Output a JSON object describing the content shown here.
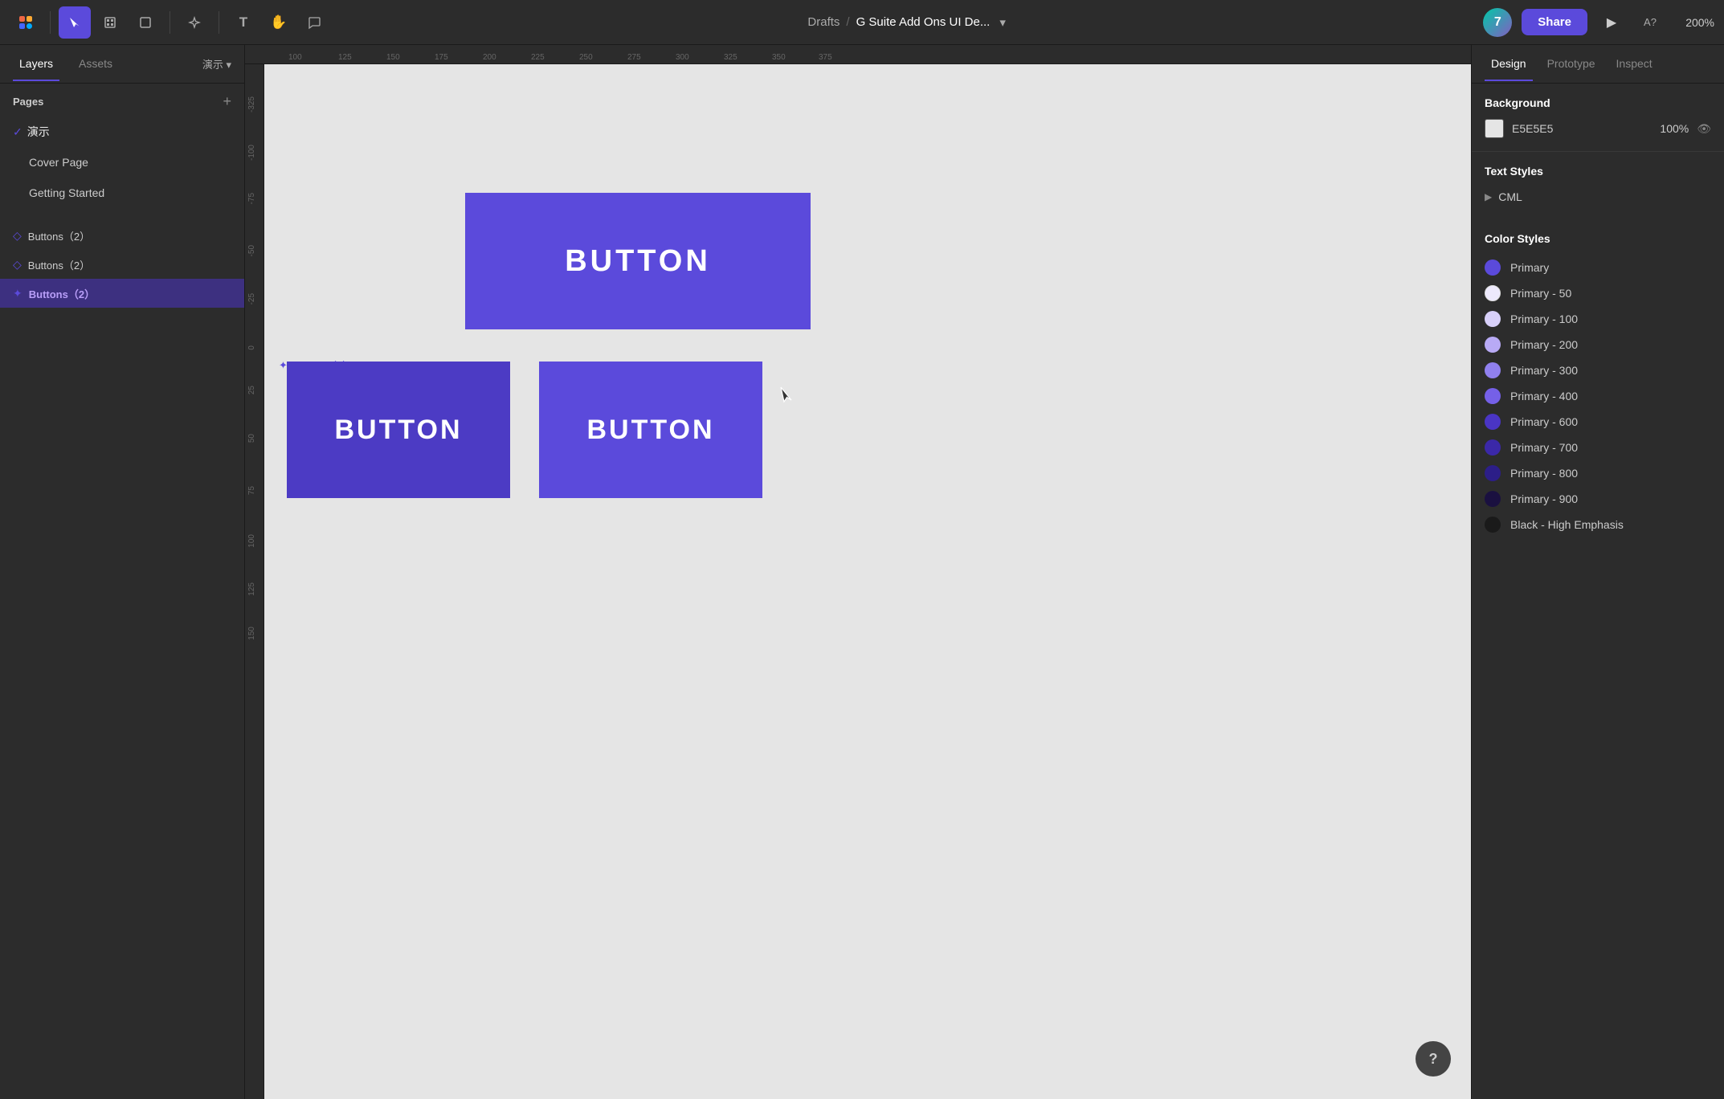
{
  "toolbar": {
    "breadcrumb_drafts": "Drafts",
    "breadcrumb_sep": "/",
    "page_title": "G Suite Add Ons UI De...",
    "share_label": "Share",
    "zoom_level": "200%",
    "avatar_initials": "7"
  },
  "left_panel": {
    "tabs": [
      {
        "id": "layers",
        "label": "Layers"
      },
      {
        "id": "assets",
        "label": "Assets"
      }
    ],
    "pages_section_title": "Pages",
    "pages": [
      {
        "id": "yanshi",
        "label": "演示",
        "active": true
      },
      {
        "id": "cover",
        "label": "Cover Page"
      },
      {
        "id": "getting-started",
        "label": "Getting Started"
      }
    ],
    "layers": [
      {
        "id": "buttons-1",
        "label": "Buttons（2）",
        "icon": "diamond",
        "active": false
      },
      {
        "id": "buttons-2",
        "label": "Buttons（2）",
        "icon": "diamond",
        "active": false
      },
      {
        "id": "buttons-3",
        "label": "Buttons（2）",
        "icon": "star",
        "active": true
      }
    ]
  },
  "canvas": {
    "selection_label": "Buttons（2）",
    "buttons": [
      {
        "id": "btn1",
        "label": "BUTTON"
      },
      {
        "id": "btn2",
        "label": "BUTTON"
      },
      {
        "id": "btn3",
        "label": "BUTTON"
      }
    ]
  },
  "right_panel": {
    "tabs": [
      {
        "id": "design",
        "label": "Design",
        "active": true
      },
      {
        "id": "prototype",
        "label": "Prototype"
      },
      {
        "id": "inspect",
        "label": "Inspect"
      }
    ],
    "background_section_title": "Background",
    "background_color_hex": "E5E5E5",
    "background_opacity": "100%",
    "text_styles_section_title": "Text Styles",
    "text_styles_cml": "CML",
    "color_styles_section_title": "Color Styles",
    "color_styles": [
      {
        "id": "primary",
        "label": "Primary",
        "color": "#5b4adb"
      },
      {
        "id": "primary-50",
        "label": "Primary - 50",
        "color": "#ede9fc"
      },
      {
        "id": "primary-100",
        "label": "Primary - 100",
        "color": "#d8d0f9"
      },
      {
        "id": "primary-200",
        "label": "Primary - 200",
        "color": "#b8aaf5"
      },
      {
        "id": "primary-300",
        "label": "Primary - 300",
        "color": "#9080ef"
      },
      {
        "id": "primary-400",
        "label": "Primary - 400",
        "color": "#7560e8"
      },
      {
        "id": "primary-600",
        "label": "Primary - 600",
        "color": "#4a35c4"
      },
      {
        "id": "primary-700",
        "label": "Primary - 700",
        "color": "#3b28a8"
      },
      {
        "id": "primary-800",
        "label": "Primary - 800",
        "color": "#2c1e88"
      },
      {
        "id": "primary-900",
        "label": "Primary - 900",
        "color": "#1a1040"
      },
      {
        "id": "black-high",
        "label": "Black - High Emphasis",
        "color": "#1a1a1a"
      }
    ]
  },
  "help_btn_label": "?"
}
